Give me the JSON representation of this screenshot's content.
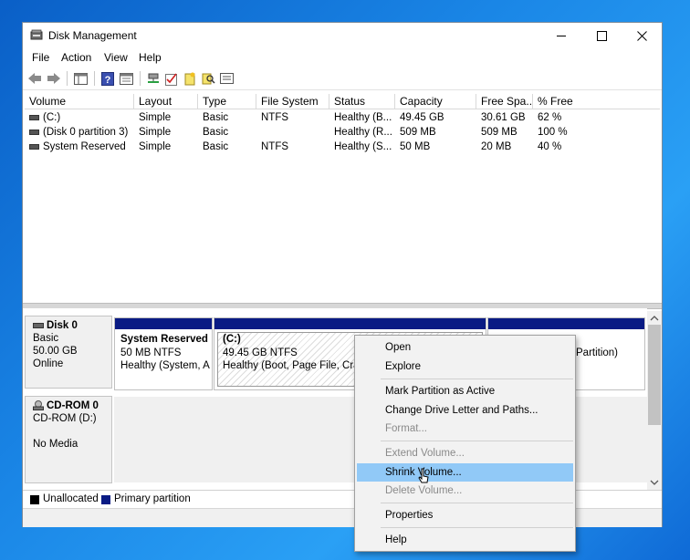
{
  "window": {
    "title": "Disk Management",
    "title_icon": "disk-management-icon"
  },
  "controls": {
    "minimize": "minimize-icon",
    "maximize": "maximize-icon",
    "close": "close-icon"
  },
  "menu": [
    "File",
    "Action",
    "View",
    "Help"
  ],
  "toolbar": [
    "back-icon",
    "forward-icon",
    "show-hide-console-tree-icon",
    "help-icon",
    "properties-icon",
    "connect-icon",
    "check-icon",
    "new-icon",
    "search-icon",
    "list-icon"
  ],
  "columns": [
    "Volume",
    "Layout",
    "Type",
    "File System",
    "Status",
    "Capacity",
    "Free Spa...",
    "% Free"
  ],
  "volumes": [
    {
      "volume": "(C:)",
      "layout": "Simple",
      "type": "Basic",
      "fs": "NTFS",
      "status": "Healthy (B...",
      "capacity": "49.45 GB",
      "free": "30.61 GB",
      "pct": "62 %"
    },
    {
      "volume": "(Disk 0 partition 3)",
      "layout": "Simple",
      "type": "Basic",
      "fs": "",
      "status": "Healthy (R...",
      "capacity": "509 MB",
      "free": "509 MB",
      "pct": "100 %"
    },
    {
      "volume": "System Reserved",
      "layout": "Simple",
      "type": "Basic",
      "fs": "NTFS",
      "status": "Healthy (S...",
      "capacity": "50 MB",
      "free": "20 MB",
      "pct": "40 %"
    }
  ],
  "disks": [
    {
      "name": "Disk 0",
      "type": "Basic",
      "size": "50.00 GB",
      "state": "Online"
    },
    {
      "name": "CD-ROM 0",
      "type": "CD-ROM (D:)",
      "state": "No Media"
    }
  ],
  "partitions": [
    {
      "name": "System Reserved",
      "size": "50 MB NTFS",
      "status": "Healthy (System, A"
    },
    {
      "name": "(C:)",
      "size": "49.45 GB NTFS",
      "status": "Healthy (Boot, Page File, Crash"
    },
    {
      "status": "Partition)"
    }
  ],
  "legend": {
    "unallocated": "Unallocated",
    "primary": "Primary partition"
  },
  "colors": {
    "unallocated": "#000000",
    "primary": "#0a1b84"
  },
  "context_menu": {
    "items": [
      {
        "label": "Open",
        "enabled": true
      },
      {
        "label": "Explore",
        "enabled": true
      },
      {
        "label": "Mark Partition as Active",
        "enabled": true
      },
      {
        "label": "Change Drive Letter and Paths...",
        "enabled": true
      },
      {
        "label": "Format...",
        "enabled": false
      },
      {
        "label": "Extend Volume...",
        "enabled": false
      },
      {
        "label": "Shrink Volume...",
        "enabled": true,
        "highlighted": true
      },
      {
        "label": "Delete Volume...",
        "enabled": false
      },
      {
        "label": "Properties",
        "enabled": true
      },
      {
        "label": "Help",
        "enabled": true
      }
    ]
  }
}
